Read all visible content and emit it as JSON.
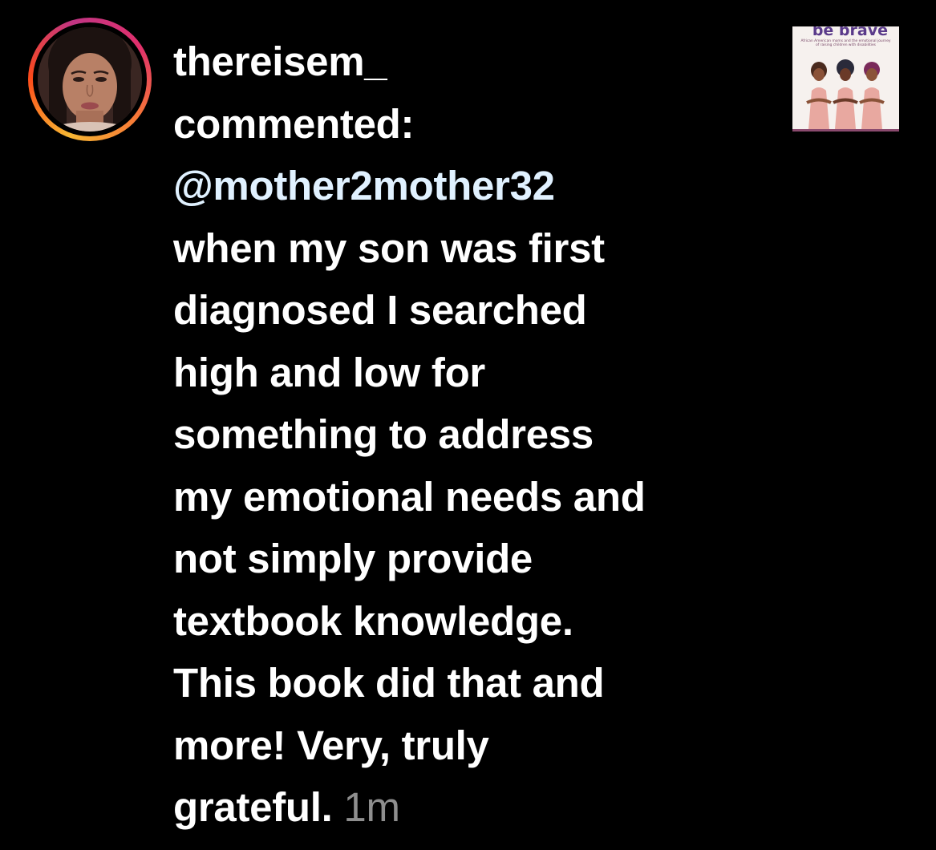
{
  "notification": {
    "username": "thereisem_",
    "action": "commented:",
    "mention": "@mother2mother32",
    "comment_lines": [
      "when my son was first",
      "diagnosed I searched",
      "high and low for",
      "something to address",
      "my emotional needs and",
      "not simply provide",
      "textbook knowledge.",
      "This book did that and",
      "more! Very, truly"
    ],
    "comment_last_line": "grateful.",
    "timestamp": "1m"
  },
  "post_thumbnail": {
    "title": "be brave",
    "subtitle": "African American moms and the emotional journey of raising children with disabilities"
  },
  "colors": {
    "background": "#000000",
    "text": "#ffffff",
    "mention": "#e0f1ff",
    "timestamp": "#8e8e8e",
    "story_ring": [
      "#f7b733",
      "#fc4a1a",
      "#c13584",
      "#e1306c"
    ]
  }
}
